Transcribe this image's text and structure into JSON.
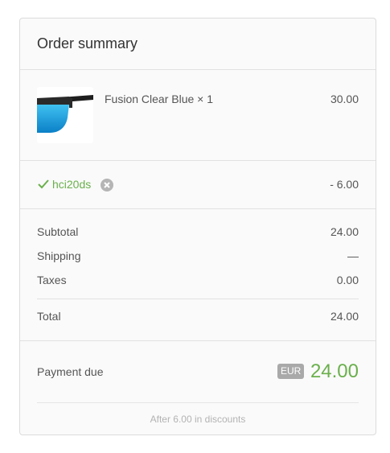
{
  "header": {
    "title": "Order summary"
  },
  "line_item": {
    "name": "Fusion Clear Blue",
    "quantity": "× 1",
    "price": "30.00",
    "image_icon": "sunglasses-icon"
  },
  "discount": {
    "code": "hci20ds",
    "amount": "- 6.00",
    "check_icon": "checkmark-icon",
    "remove_icon": "close-circle-icon"
  },
  "totals": {
    "subtotal_label": "Subtotal",
    "subtotal_value": "24.00",
    "shipping_label": "Shipping",
    "shipping_value": "—",
    "taxes_label": "Taxes",
    "taxes_value": "0.00",
    "total_label": "Total",
    "total_value": "24.00"
  },
  "payment": {
    "label": "Payment due",
    "currency": "EUR",
    "amount": "24.00",
    "note": "After 6.00 in discounts"
  },
  "colors": {
    "accent_green": "#6ab04c",
    "border": "#e1e1e1",
    "panel_bg": "#fafafa",
    "badge_bg": "#a9a9a9"
  }
}
